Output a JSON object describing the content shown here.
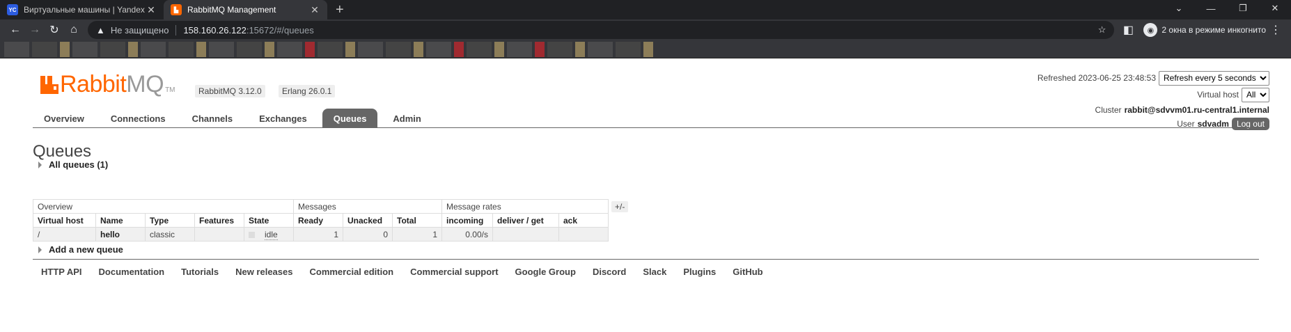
{
  "browser": {
    "tabs": [
      {
        "title": "Виртуальные машины | Yandex Cloud",
        "favicon": "YC",
        "active": false
      },
      {
        "title": "RabbitMQ Management",
        "favicon": "rabbitmq",
        "active": true
      }
    ],
    "new_tab": "+",
    "address": {
      "insecure_label": "Не защищено",
      "host": "158.160.26.122",
      "path": ":15672/#/queues"
    },
    "incognito_label": "2 окна в режиме инкогнито"
  },
  "app": {
    "logo_rabbit": "Rabbit",
    "logo_mq": "MQ",
    "logo_tm": "TM",
    "rabbitmq_version": "RabbitMQ 3.12.0",
    "erlang_version": "Erlang 26.0.1",
    "refreshed_label": "Refreshed 2023-06-25 23:48:53",
    "refresh_option": "Refresh every 5 seconds",
    "virtual_host_label": "Virtual host",
    "virtual_host_option": "All",
    "cluster_label": "Cluster",
    "cluster_name": "rabbit@sdvvm01.ru-central1.internal",
    "user_label": "User",
    "user_name": "sdvadm",
    "logout_label": "Log out"
  },
  "nav_tabs": [
    {
      "label": "Overview",
      "active": false
    },
    {
      "label": "Connections",
      "active": false
    },
    {
      "label": "Channels",
      "active": false
    },
    {
      "label": "Exchanges",
      "active": false
    },
    {
      "label": "Queues",
      "active": true
    },
    {
      "label": "Admin",
      "active": false
    }
  ],
  "page_title": "Queues",
  "all_queues_label": "All queues (1)",
  "table": {
    "groups": [
      "Overview",
      "Messages",
      "Message rates"
    ],
    "columns": [
      "Virtual host",
      "Name",
      "Type",
      "Features",
      "State",
      "Ready",
      "Unacked",
      "Total",
      "incoming",
      "deliver / get",
      "ack"
    ],
    "rows": [
      {
        "vhost": "/",
        "name": "hello",
        "type": "classic",
        "features": "",
        "state": "idle",
        "ready": "1",
        "unacked": "0",
        "total": "1",
        "incoming": "0.00/s",
        "deliver_get": "",
        "ack": ""
      }
    ],
    "columns_toggle": "+/-"
  },
  "add_queue_label": "Add a new queue",
  "footer_links": [
    "HTTP API",
    "Documentation",
    "Tutorials",
    "New releases",
    "Commercial edition",
    "Commercial support",
    "Google Group",
    "Discord",
    "Slack",
    "Plugins",
    "GitHub"
  ]
}
